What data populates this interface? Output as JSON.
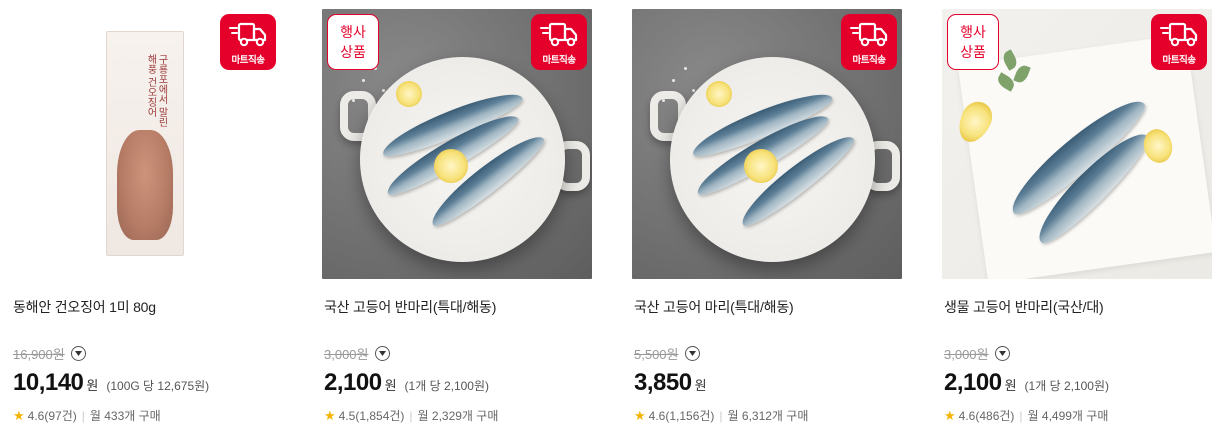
{
  "badges": {
    "delivery_label": "마트직송",
    "event_line1": "행사",
    "event_line2": "상품"
  },
  "colors": {
    "accent": "#e4002b",
    "star": "#f5b400"
  },
  "products": [
    {
      "name": "동해안 건오징어 1미 80g",
      "original_price": "16,900",
      "original_unit": "원",
      "price": "10,140",
      "price_unit": "원",
      "unit_price": "(100G 당 12,675원)",
      "rating": "4.6",
      "reviews": "(97건)",
      "monthly": "월 433개 구매",
      "event": false,
      "package_text": "구룡포에서 말린 해풍 건오징어"
    },
    {
      "name": "국산 고등어 반마리(특대/해동)",
      "original_price": "3,000",
      "original_unit": "원",
      "price": "2,100",
      "price_unit": "원",
      "unit_price": "(1개 당 2,100원)",
      "rating": "4.5",
      "reviews": "(1,854건)",
      "monthly": "월 2,329개 구매",
      "event": true
    },
    {
      "name": "국산 고등어 마리(특대/해동)",
      "original_price": "5,500",
      "original_unit": "원",
      "price": "3,850",
      "price_unit": "원",
      "unit_price": "",
      "rating": "4.6",
      "reviews": "(1,156건)",
      "monthly": "월 6,312개 구매",
      "event": false
    },
    {
      "name": "생물 고등어 반마리(국산/대)",
      "original_price": "3,000",
      "original_unit": "원",
      "price": "2,100",
      "price_unit": "원",
      "unit_price": "(1개 당 2,100원)",
      "rating": "4.6",
      "reviews": "(486건)",
      "monthly": "월 4,499개 구매",
      "event": true
    }
  ]
}
